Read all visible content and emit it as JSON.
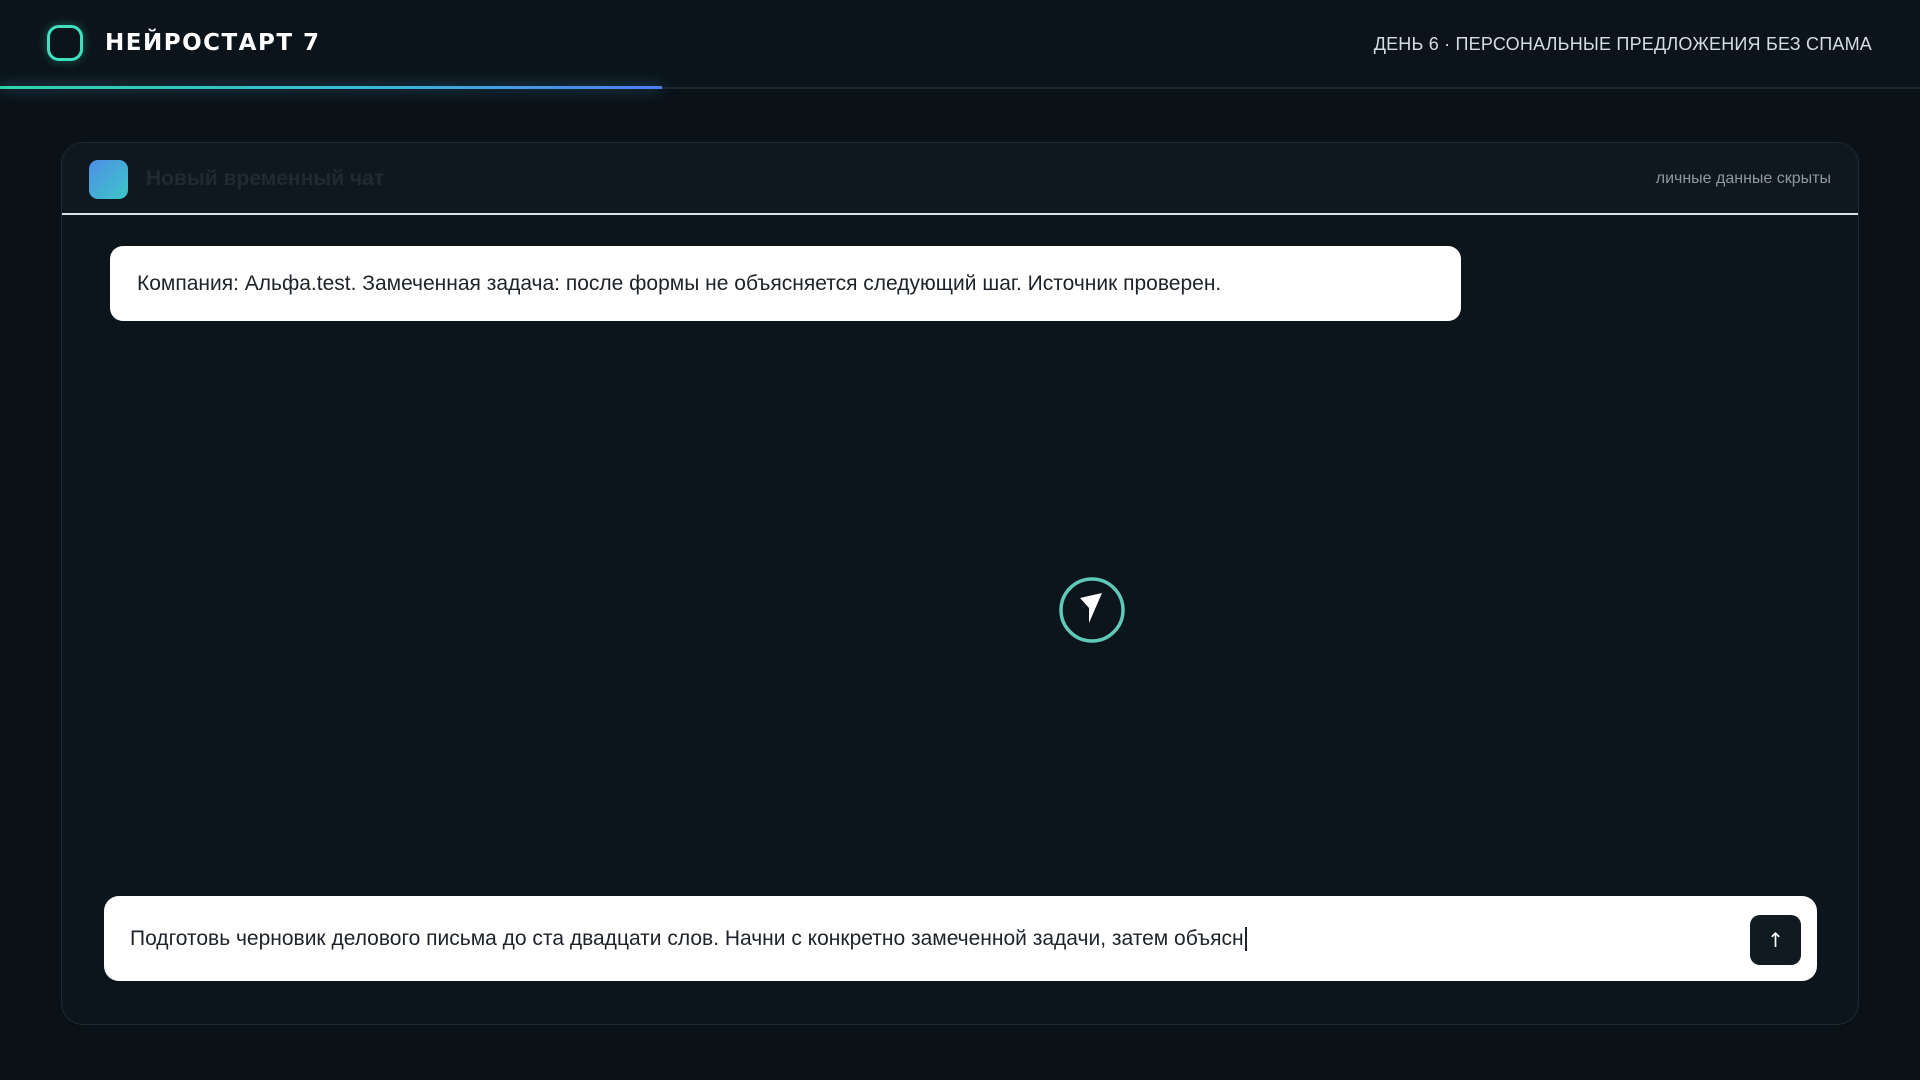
{
  "header": {
    "brand": "НЕЙРОСТАРТ 7",
    "day_label": "ДЕНЬ 6 · ПЕРСОНАЛЬНЫЕ ПРЕДЛОЖЕНИЯ БЕЗ СПАМА",
    "progress": 0.345
  },
  "chat": {
    "title": "Новый временный чат",
    "privacy_note": "личные данные скрыты",
    "messages": [
      {
        "text": "Компания: Альфа.test. Замеченная задача: после формы не объясняется следующий шаг. Источник проверен."
      }
    ]
  },
  "composer": {
    "value": "Подготовь черновик делового письма до ста двадцати слов. Начни с конкретно замеченной задачи, затем объясн",
    "send_icon": "arrow-up-icon",
    "send_glyph": "↑"
  },
  "colors": {
    "background": "#0a1117",
    "panel": "#0c151c",
    "accent": "#3fe0c0",
    "progress_end": "#4f7df0"
  }
}
